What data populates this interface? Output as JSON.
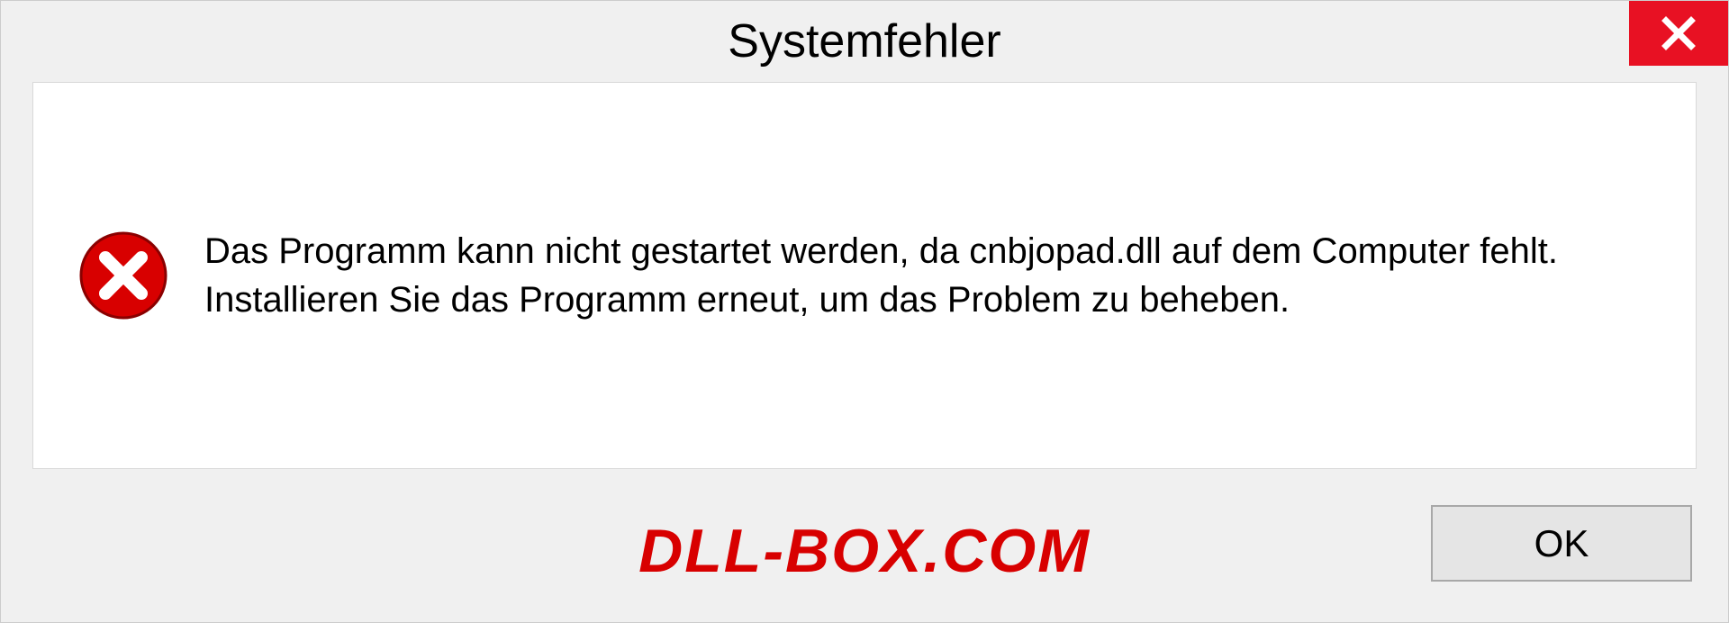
{
  "dialog": {
    "title": "Systemfehler",
    "message": "Das Programm kann nicht gestartet werden, da cnbjopad.dll auf dem Computer fehlt. Installieren Sie das Programm erneut, um das Problem zu beheben.",
    "ok_label": "OK"
  },
  "watermark": "DLL-BOX.COM",
  "colors": {
    "close_bg": "#e81123",
    "error_icon": "#d80000",
    "watermark": "#d80000"
  }
}
